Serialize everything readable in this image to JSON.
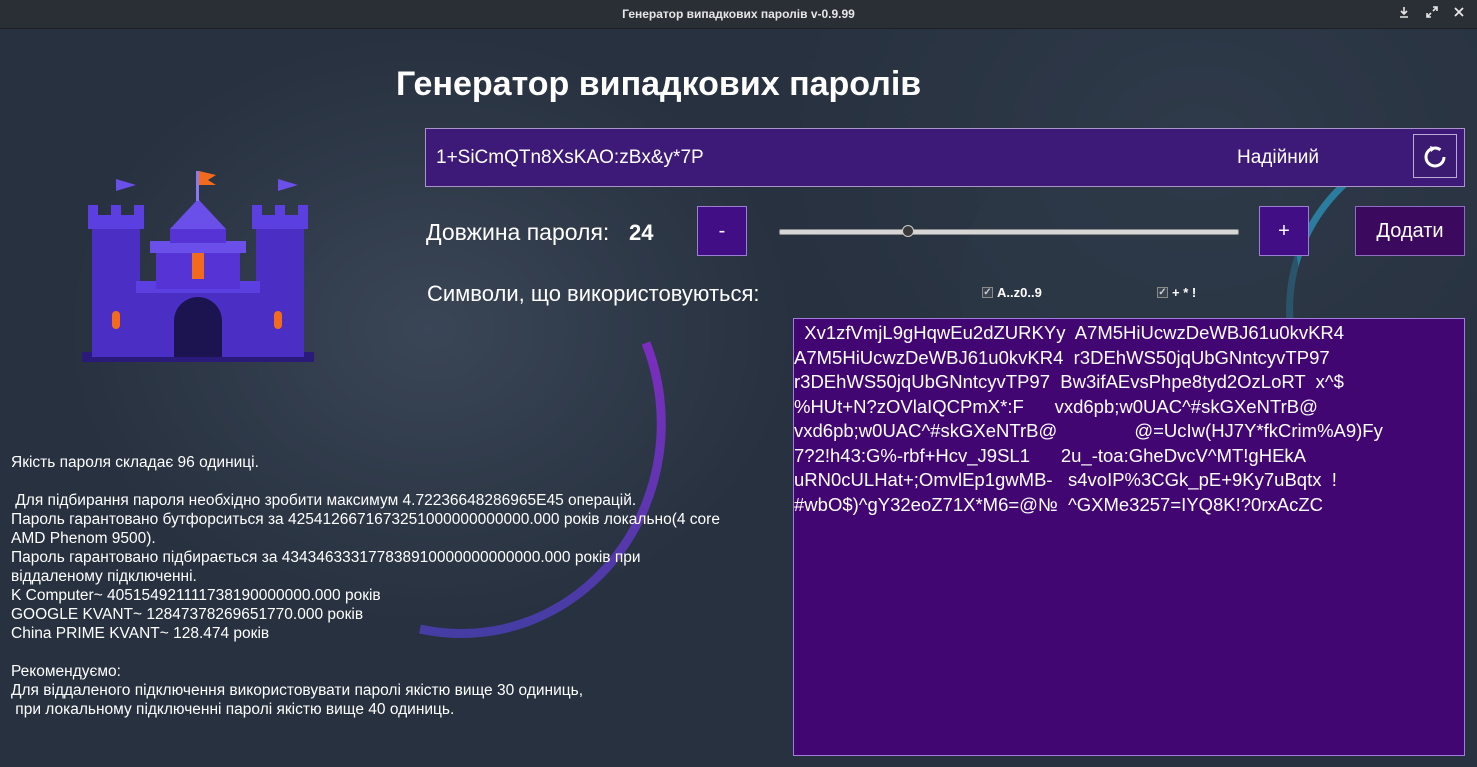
{
  "window": {
    "title": "Генератор випадкових паролів v-0.9.99",
    "controls": [
      "download-icon",
      "maximize-icon",
      "close-icon"
    ]
  },
  "main": {
    "heading": "Генератор випадкових паролів",
    "password": {
      "value": "1+SiCmQTn8XsKAO:zBx&y*7P",
      "strength": "Надійний",
      "refresh_icon": "refresh-icon"
    },
    "length": {
      "label": "Довжина пароля:",
      "value": "24",
      "minus_label": "-",
      "plus_label": "+",
      "slider_fraction": 0.28,
      "add_label": "Додати"
    },
    "symbols": {
      "label": "Символи, що використовуються:",
      "options": [
        {
          "label": "A..z0..9",
          "checked": true
        },
        {
          "label": "+ * !",
          "checked": true
        }
      ]
    },
    "output_lines": [
      "  Xv1zfVmjL9gHqwEu2dZURKYy  A7M5HiUcwzDeWBJ61u0kvKR4",
      "A7M5HiUcwzDeWBJ61u0kvKR4  r3DEhWS50jqUbGNntcyvTP97",
      "r3DEhWS50jqUbGNntcyvTP97  Bw3ifAEvsPhpe8tyd2OzLoRT  x^$",
      "%HUt+N?zOVlaIQCPmX*:F      vxd6pb;w0UAC^#skGXeNTrB@",
      "vxd6pb;w0UAC^#skGXeNTrB@               @=UcIw(HJ7Y*fkCrim%A9)Fy",
      "7?2!h43:G%-rbf+Hcv_J9SL1      2u_-toa:GheDvcV^MT!gHEkA",
      "uRN0cULHat+;OmvlEp1gwMB-   s4voIP%3CGk_pE+9Ky7uBqtx  !",
      "#wbO$)^gY32eoZ71X*M6=@№  ^GXMe3257=IYQ8K!?0rxAcZC"
    ],
    "info_lines": [
      "Якість пароля складає 96 одиниці.",
      "",
      " Для підбирання пароля необхідно зробити максимум 4.72236648286965E45 операцій.",
      "Пароль гарантовано бутфорситься за 4254126671673251000000000000.000 років локально(4 core",
      "AMD Phenom 9500).",
      "Пароль гарантовано підбирається за 434346333177838910000000000000.000 років при",
      "віддаленому підключенні.",
      "K Computer~ 405154921111738190000000.000 років",
      "GOOGLE KVANT~ 12847378269651770.000 років",
      "China PRIME KVANT~ 128.474 років",
      "",
      "Рекомендуємо:",
      "Для віддаленого підключення використовувати паролі якістю вище 30 одиниць,",
      " при локальному підключенні паролі якістю вище 40 одиниць."
    ]
  },
  "colors": {
    "background": "#27313f",
    "password_box": "#3d1a78",
    "output_box": "#420673",
    "button": "#420e85",
    "add_button": "#3b0a5e",
    "castle": "#4b2fc4",
    "castle_accent": "#f26b1d"
  },
  "logo_icon": "castle-icon"
}
